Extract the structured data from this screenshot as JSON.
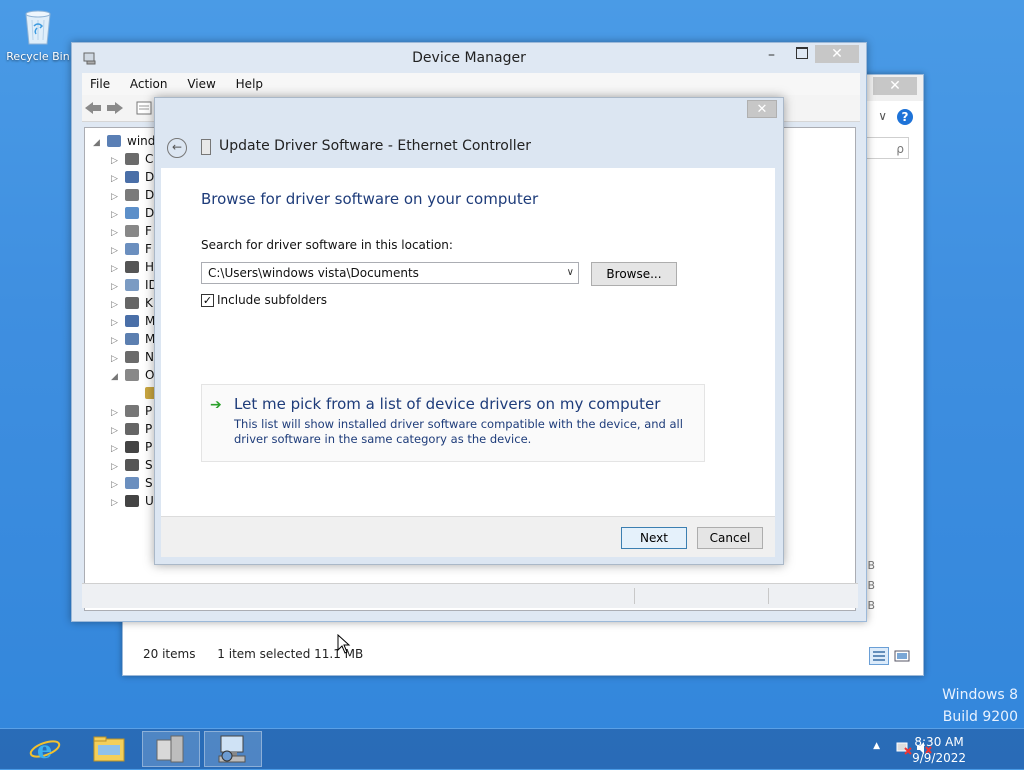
{
  "desktop": {
    "recycle_bin_label": "Recycle Bin",
    "watermark_os": "Windows 8",
    "watermark_build": "Build 9200"
  },
  "explorer": {
    "close_symbol": "✕",
    "help_symbol": "?",
    "chevron_symbol": "∨",
    "search_symbol": "ρ",
    "status_items": "20 items",
    "status_selected": "1 item selected  11.1 MB",
    "kb_values": [
      "B",
      "B",
      "B"
    ]
  },
  "device_manager": {
    "title": "Device Manager",
    "minimize_symbol": "–",
    "close_symbol": "✕",
    "menu": [
      "File",
      "Action",
      "View",
      "Help"
    ],
    "tree": [
      {
        "label": "wind",
        "arrow": "◢"
      },
      {
        "label": "C",
        "arrow": "▷"
      },
      {
        "label": "D",
        "arrow": "▷"
      },
      {
        "label": "D",
        "arrow": "▷"
      },
      {
        "label": "D",
        "arrow": "▷"
      },
      {
        "label": "F",
        "arrow": "▷"
      },
      {
        "label": "F",
        "arrow": "▷"
      },
      {
        "label": "H",
        "arrow": "▷"
      },
      {
        "label": "ID",
        "arrow": "▷"
      },
      {
        "label": "K",
        "arrow": "▷"
      },
      {
        "label": "M",
        "arrow": "▷"
      },
      {
        "label": "M",
        "arrow": "▷"
      },
      {
        "label": "N",
        "arrow": "▷"
      },
      {
        "label": "O",
        "arrow": "◢"
      },
      {
        "label": "",
        "arrow": ""
      },
      {
        "label": "P",
        "arrow": "▷"
      },
      {
        "label": "P",
        "arrow": "▷"
      },
      {
        "label": "P",
        "arrow": "▷"
      },
      {
        "label": "S",
        "arrow": "▷"
      },
      {
        "label": "S",
        "arrow": "▷"
      },
      {
        "label": "U",
        "arrow": "▷"
      }
    ]
  },
  "wizard": {
    "close_symbol": "✕",
    "back_symbol": "←",
    "title": "Update Driver Software - Ethernet Controller",
    "heading": "Browse for driver software on your computer",
    "search_label": "Search for driver software in this location:",
    "path_value": "C:\\Users\\windows vista\\Documents",
    "dropdown_symbol": "∨",
    "browse_label": "Browse...",
    "include_subfolders_label": "Include subfolders",
    "checkmark": "✓",
    "pick_arrow": "➔",
    "pick_title": "Let me pick from a list of device drivers on my computer",
    "pick_description": "This list will show installed driver software compatible with the device, and all driver software in the same category as the device.",
    "next_label": "Next",
    "cancel_label": "Cancel"
  },
  "taskbar": {
    "time": "8:30 AM",
    "date": "9/9/2022",
    "tray_up_symbol": "▲",
    "ie_glyph": "e"
  }
}
